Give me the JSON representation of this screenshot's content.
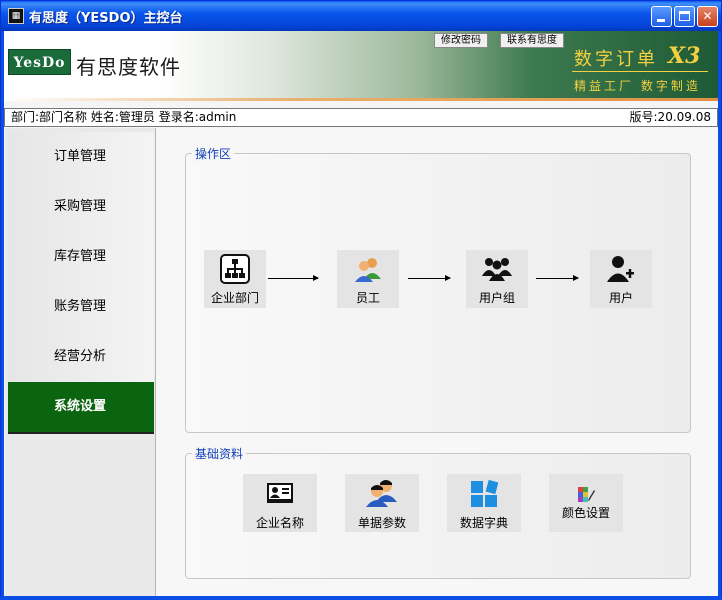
{
  "window": {
    "title": "有思度（YESDO）主控台",
    "minimize_label": "",
    "maximize_label": "",
    "close_label": "✕"
  },
  "header": {
    "logo_text": "YesDo",
    "company_name": "有思度软件",
    "change_password": "修改密码",
    "contact": "联系有思度",
    "product_name": "数字订单",
    "product_version": "X3",
    "slogan": "精益工厂 数字制造"
  },
  "status": {
    "left": "部门:部门名称  姓名:管理员  登录名:admin",
    "version": "版号:20.09.08"
  },
  "sidebar": {
    "items": [
      {
        "label": "订单管理"
      },
      {
        "label": "采购管理"
      },
      {
        "label": "库存管理"
      },
      {
        "label": "账务管理"
      },
      {
        "label": "经营分析"
      },
      {
        "label": "系统设置"
      }
    ],
    "active_index": 5
  },
  "operations": {
    "title": "操作区",
    "tiles": [
      {
        "label": "企业部门",
        "icon": "org-chart-icon"
      },
      {
        "label": "员工",
        "icon": "employee-icon"
      },
      {
        "label": "用户组",
        "icon": "user-group-icon"
      },
      {
        "label": "用户",
        "icon": "user-icon"
      }
    ]
  },
  "basics": {
    "title": "基础资料",
    "tiles": [
      {
        "label": "企业名称",
        "icon": "company-card-icon"
      },
      {
        "label": "单据参数",
        "icon": "document-params-icon"
      },
      {
        "label": "数据字典",
        "icon": "data-dictionary-icon"
      },
      {
        "label": "颜色设置",
        "icon": "color-settings-icon"
      }
    ]
  },
  "colors": {
    "active_nav": "#0b6410",
    "panel_title": "#1240b8",
    "titlebar": "#0a56ec",
    "accent_gold": "#f5d040"
  }
}
